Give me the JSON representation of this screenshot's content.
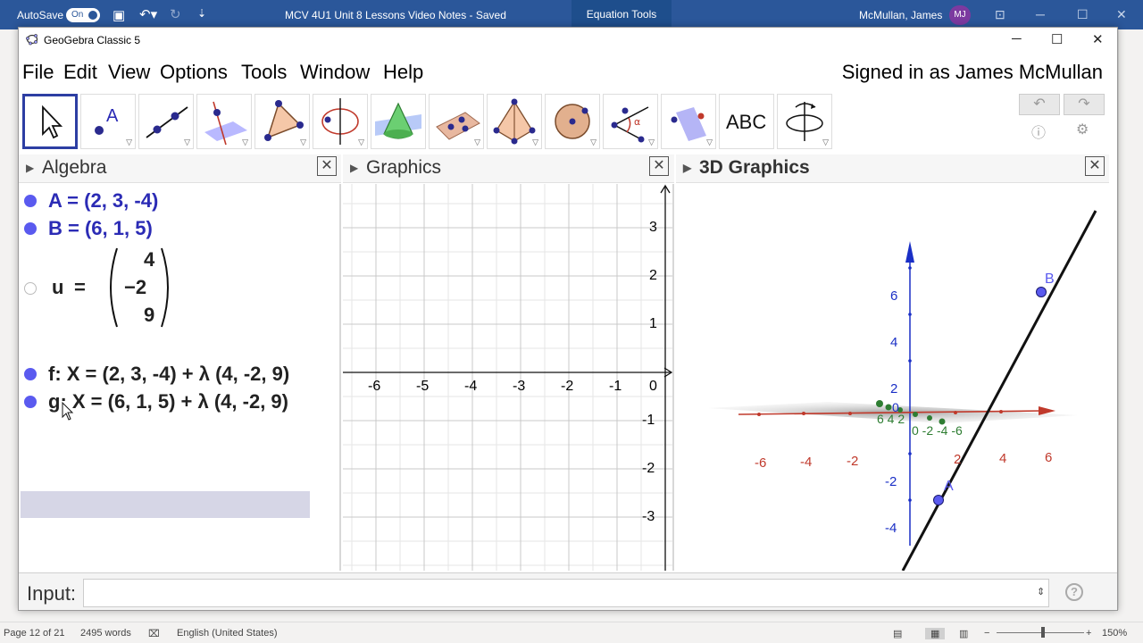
{
  "word": {
    "autosave_label": "AutoSave",
    "autosave_state": "On",
    "doc_title": "MCV 4U1 Unit 8 Lessons Video Notes  -  Saved",
    "context_tab": "Equation Tools",
    "user_name": "McMullan, James",
    "user_initials": "MJ",
    "status": {
      "page": "Page 12 of 21",
      "words": "2495 words",
      "language": "English (United States)",
      "zoom": "150%"
    }
  },
  "geogebra": {
    "window_title": "GeoGebra Classic 5",
    "menu": [
      "File",
      "Edit",
      "View",
      "Options",
      "Tools",
      "Window",
      "Help"
    ],
    "signed_in": "Signed in as James McMullan",
    "tools": [
      "move-tool",
      "point-tool",
      "line-tool",
      "perpendicular-line-tool",
      "polygon-tool",
      "circle-tool",
      "pyramid-tool",
      "plane-tool",
      "intersect-tool",
      "sphere-tool",
      "angle-tool",
      "reflect-tool",
      "text-tool",
      "rotate-view-tool"
    ],
    "text_tool_label": "ABC",
    "panels": {
      "algebra": "Algebra",
      "graphics": "Graphics",
      "graphics3d": "3D Graphics"
    },
    "algebra_items": {
      "a": "A = (2, 3, -4)",
      "b": "B = (6, 1, 5)",
      "u_label": "u",
      "u_eq": "=",
      "u_vec": [
        "4",
        "−2",
        "9"
      ],
      "f": "f: X = (2, 3, -4) + λ (4, -2, 9)",
      "g": "g: X = (6, 1, 5) + λ (4, -2, 9)"
    },
    "graphics_2d": {
      "x_ticks": [
        "-6",
        "-5",
        "-4",
        "-3",
        "-2",
        "-1",
        "0"
      ],
      "y_ticks": [
        "3",
        "2",
        "1",
        "-1",
        "-2",
        "-3"
      ]
    },
    "graphics_3d": {
      "x_ticks": [
        "-6",
        "-4",
        "-2",
        "2",
        "4",
        "6"
      ],
      "z_ticks": [
        "6",
        "4",
        "2",
        "-2",
        "-4"
      ],
      "origin_label": "0",
      "y_tick_text": "6 4 2",
      "y_tick_text2": "0 -2 -4 -6",
      "point_a": "A",
      "point_b": "B"
    },
    "input_label": "Input:",
    "input_value": "",
    "colors": {
      "algebra_blue": "#2b2bb5",
      "point_blue": "#5a5aef",
      "x_axis_red": "#c0392b",
      "y_axis_green": "#2e7d32",
      "z_axis_blue": "#1a2fc6",
      "word_blue": "#2b579a"
    }
  }
}
